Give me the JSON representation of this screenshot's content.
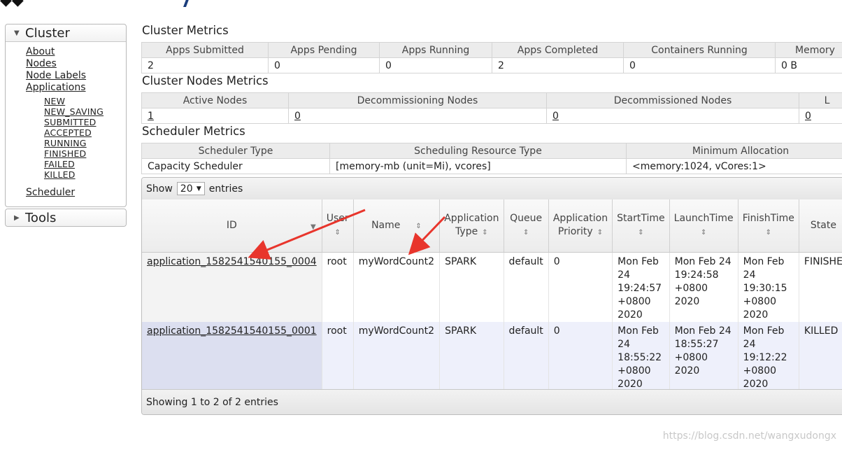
{
  "nav": {
    "cluster_title": "Cluster",
    "links": [
      "About",
      "Nodes",
      "Node Labels",
      "Applications"
    ],
    "app_states": [
      "NEW",
      "NEW_SAVING",
      "SUBMITTED",
      "ACCEPTED",
      "RUNNING",
      "FINISHED",
      "FAILED",
      "KILLED"
    ],
    "scheduler": "Scheduler",
    "tools_title": "Tools"
  },
  "cluster_metrics": {
    "title": "Cluster Metrics",
    "headers": [
      "Apps Submitted",
      "Apps Pending",
      "Apps Running",
      "Apps Completed",
      "Containers Running",
      "Memory"
    ],
    "values": [
      "2",
      "0",
      "0",
      "2",
      "0",
      "0 B"
    ]
  },
  "nodes_metrics": {
    "title": "Cluster Nodes Metrics",
    "headers": [
      "Active Nodes",
      "Decommissioning Nodes",
      "Decommissioned Nodes",
      "L"
    ],
    "values": [
      "1",
      "0",
      "0",
      "0"
    ]
  },
  "scheduler_metrics": {
    "title": "Scheduler Metrics",
    "headers": [
      "Scheduler Type",
      "Scheduling Resource Type",
      "Minimum Allocation"
    ],
    "values": [
      "Capacity Scheduler",
      "[memory-mb (unit=Mi), vcores]",
      "<memory:1024, vCores:1>"
    ]
  },
  "apps": {
    "show_label": "Show",
    "page_size": "20",
    "entries_label": "entries",
    "columns": [
      "ID",
      "User",
      "Name",
      "Application Type",
      "Queue",
      "Application Priority",
      "StartTime",
      "LaunchTime",
      "FinishTime",
      "State"
    ],
    "rows": [
      {
        "id": "application_1582541540155_0004",
        "user": "root",
        "name": "myWordCount2",
        "type": "SPARK",
        "queue": "default",
        "priority": "0",
        "start": [
          "Mon Feb",
          "24",
          "19:24:57",
          "+0800",
          "2020"
        ],
        "launch": [
          "Mon Feb 24",
          "19:24:58",
          "+0800 2020"
        ],
        "finish": [
          "Mon Feb",
          "24",
          "19:30:15",
          "+0800",
          "2020"
        ],
        "state": "FINISHE"
      },
      {
        "id": "application_1582541540155_0001",
        "user": "root",
        "name": "myWordCount2",
        "type": "SPARK",
        "queue": "default",
        "priority": "0",
        "start": [
          "Mon Feb",
          "24",
          "18:55:22",
          "+0800",
          "2020"
        ],
        "launch": [
          "Mon Feb 24",
          "18:55:27",
          "+0800 2020"
        ],
        "finish": [
          "Mon Feb",
          "24",
          "19:12:22",
          "+0800",
          "2020"
        ],
        "state": "KILLED"
      }
    ],
    "footer": "Showing 1 to 2 of 2 entries"
  },
  "watermark": "https://blog.csdn.net/wangxudongx",
  "colors": {
    "arrow": "#e8352c",
    "id_cell": "#f3f3f3",
    "row_alt": "#eef0fb"
  }
}
